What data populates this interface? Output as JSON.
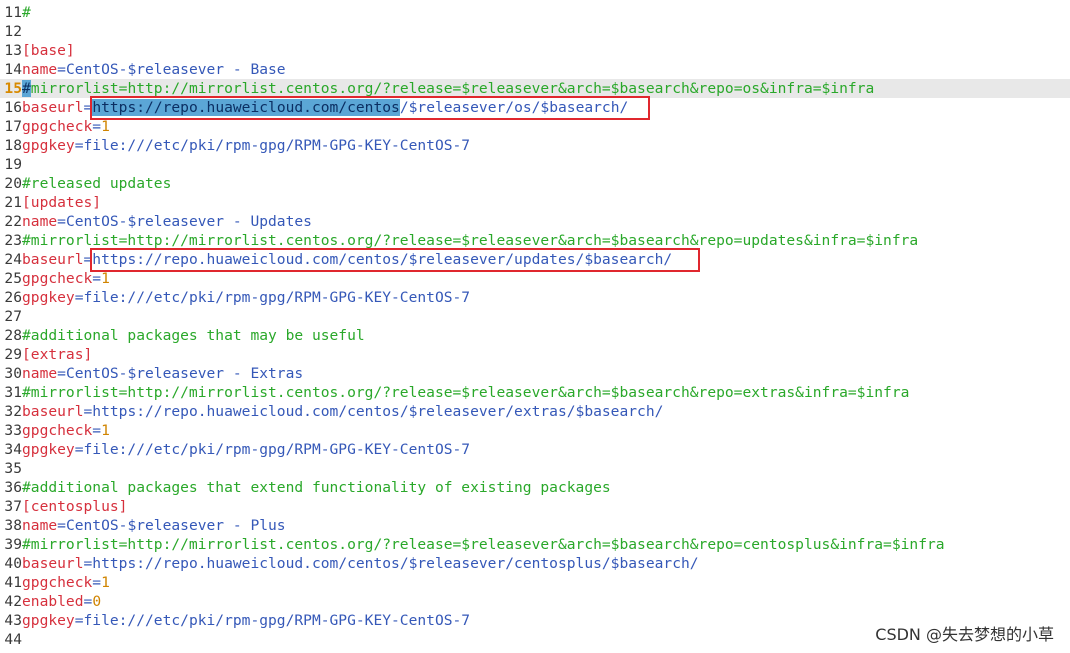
{
  "lines": [
    {
      "n": "11",
      "parts": [
        {
          "t": "#",
          "c": "cmt"
        }
      ]
    },
    {
      "n": "12",
      "parts": []
    },
    {
      "n": "13",
      "parts": [
        {
          "t": "[base]",
          "c": "sec"
        }
      ]
    },
    {
      "n": "14",
      "parts": [
        {
          "t": "name",
          "c": "key"
        },
        {
          "t": "=CentOS-$releasever - Base",
          "c": "val"
        }
      ]
    },
    {
      "n": "15",
      "current": true,
      "parts": [
        {
          "t": "#",
          "c": "cmt hl"
        },
        {
          "t": "mirrorlist=http://mirrorlist.centos.org/?release=$releasever&arch=$basearch&repo=os&infra=$infra",
          "c": "cmt"
        }
      ]
    },
    {
      "n": "16",
      "parts": [
        {
          "t": "baseurl",
          "c": "key"
        },
        {
          "t": "=",
          "c": "val"
        },
        {
          "t": "https://repo.huaweicloud.com/centos",
          "c": "hl"
        },
        {
          "t": "/$releasever/os/$basearch/",
          "c": "val"
        }
      ]
    },
    {
      "n": "17",
      "parts": [
        {
          "t": "gpgcheck",
          "c": "key"
        },
        {
          "t": "=",
          "c": "val"
        },
        {
          "t": "1",
          "c": "num"
        }
      ]
    },
    {
      "n": "18",
      "parts": [
        {
          "t": "gpgkey",
          "c": "key"
        },
        {
          "t": "=file:///etc/pki/rpm-gpg/RPM-GPG-KEY-CentOS-7",
          "c": "val"
        }
      ]
    },
    {
      "n": "19",
      "parts": []
    },
    {
      "n": "20",
      "parts": [
        {
          "t": "#released updates",
          "c": "cmt"
        }
      ]
    },
    {
      "n": "21",
      "parts": [
        {
          "t": "[updates]",
          "c": "sec"
        }
      ]
    },
    {
      "n": "22",
      "parts": [
        {
          "t": "name",
          "c": "key"
        },
        {
          "t": "=CentOS-$releasever - Updates",
          "c": "val"
        }
      ]
    },
    {
      "n": "23",
      "parts": [
        {
          "t": "#mirrorlist=http://mirrorlist.centos.org/?release=$releasever&arch=$basearch&repo=updates&infra=$infra",
          "c": "cmt"
        }
      ]
    },
    {
      "n": "24",
      "parts": [
        {
          "t": "baseurl",
          "c": "key"
        },
        {
          "t": "=https://repo.huaweicloud.com/centos/$releasever/updates/$basearch/",
          "c": "val"
        }
      ]
    },
    {
      "n": "25",
      "parts": [
        {
          "t": "gpgcheck",
          "c": "key"
        },
        {
          "t": "=",
          "c": "val"
        },
        {
          "t": "1",
          "c": "num"
        }
      ]
    },
    {
      "n": "26",
      "parts": [
        {
          "t": "gpgkey",
          "c": "key"
        },
        {
          "t": "=file:///etc/pki/rpm-gpg/RPM-GPG-KEY-CentOS-7",
          "c": "val"
        }
      ]
    },
    {
      "n": "27",
      "parts": []
    },
    {
      "n": "28",
      "parts": [
        {
          "t": "#additional packages that may be useful",
          "c": "cmt"
        }
      ]
    },
    {
      "n": "29",
      "parts": [
        {
          "t": "[extras]",
          "c": "sec"
        }
      ]
    },
    {
      "n": "30",
      "parts": [
        {
          "t": "name",
          "c": "key"
        },
        {
          "t": "=CentOS-$releasever - Extras",
          "c": "val"
        }
      ]
    },
    {
      "n": "31",
      "parts": [
        {
          "t": "#mirrorlist=http://mirrorlist.centos.org/?release=$releasever&arch=$basearch&repo=extras&infra=$infra",
          "c": "cmt"
        }
      ]
    },
    {
      "n": "32",
      "parts": [
        {
          "t": "baseurl",
          "c": "key"
        },
        {
          "t": "=https://repo.huaweicloud.com/centos/$releasever/extras/$basearch/",
          "c": "val"
        }
      ]
    },
    {
      "n": "33",
      "parts": [
        {
          "t": "gpgcheck",
          "c": "key"
        },
        {
          "t": "=",
          "c": "val"
        },
        {
          "t": "1",
          "c": "num"
        }
      ]
    },
    {
      "n": "34",
      "parts": [
        {
          "t": "gpgkey",
          "c": "key"
        },
        {
          "t": "=file:///etc/pki/rpm-gpg/RPM-GPG-KEY-CentOS-7",
          "c": "val"
        }
      ]
    },
    {
      "n": "35",
      "parts": []
    },
    {
      "n": "36",
      "parts": [
        {
          "t": "#additional packages that extend functionality of existing packages",
          "c": "cmt"
        }
      ]
    },
    {
      "n": "37",
      "parts": [
        {
          "t": "[centosplus]",
          "c": "sec"
        }
      ]
    },
    {
      "n": "38",
      "parts": [
        {
          "t": "name",
          "c": "key"
        },
        {
          "t": "=CentOS-$releasever - Plus",
          "c": "val"
        }
      ]
    },
    {
      "n": "39",
      "parts": [
        {
          "t": "#mirrorlist=http://mirrorlist.centos.org/?release=$releasever&arch=$basearch&repo=centosplus&infra=$infra",
          "c": "cmt"
        }
      ]
    },
    {
      "n": "40",
      "parts": [
        {
          "t": "baseurl",
          "c": "key"
        },
        {
          "t": "=https://repo.huaweicloud.com/centos/$releasever/centosplus/$basearch/",
          "c": "val"
        }
      ]
    },
    {
      "n": "41",
      "parts": [
        {
          "t": "gpgcheck",
          "c": "key"
        },
        {
          "t": "=",
          "c": "val"
        },
        {
          "t": "1",
          "c": "num"
        }
      ]
    },
    {
      "n": "42",
      "parts": [
        {
          "t": "enabled",
          "c": "key"
        },
        {
          "t": "=",
          "c": "val"
        },
        {
          "t": "0",
          "c": "num"
        }
      ]
    },
    {
      "n": "43",
      "parts": [
        {
          "t": "gpgkey",
          "c": "key"
        },
        {
          "t": "=file:///etc/pki/rpm-gpg/RPM-GPG-KEY-CentOS-7",
          "c": "val"
        }
      ]
    },
    {
      "n": "44",
      "parts": []
    }
  ],
  "watermark": "CSDN @失去梦想的小草",
  "colors": {
    "key": "#d6303d",
    "value": "#3558b8",
    "comment": "#2aa82a",
    "number": "#d08400",
    "selection": "#5ba6d6",
    "annotation_box": "#e0272e"
  }
}
